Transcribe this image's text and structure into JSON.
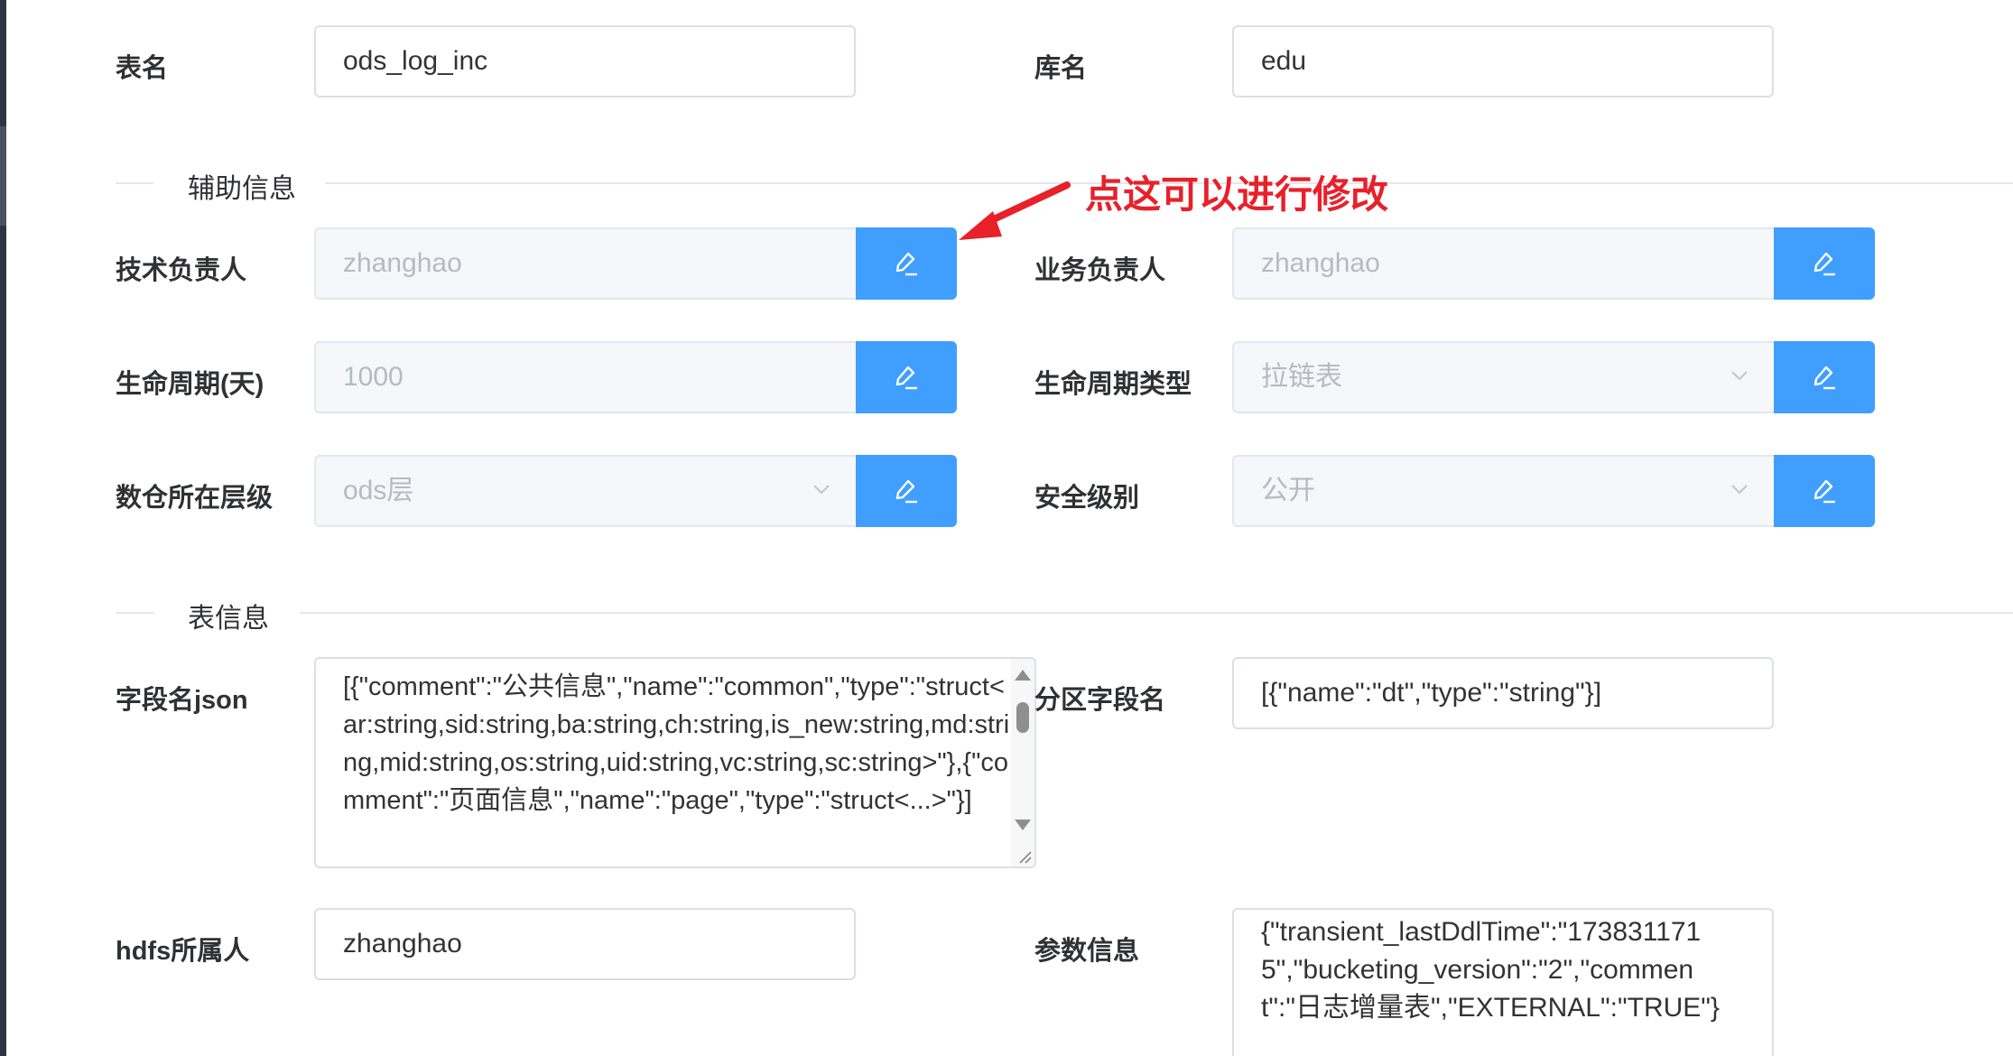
{
  "colors": {
    "accent": "#409eff",
    "annotation": "#e8202a"
  },
  "fields": {
    "table_name": {
      "label": "表名",
      "value": "ods_log_inc"
    },
    "db_name": {
      "label": "库名",
      "value": "edu"
    },
    "tech_owner": {
      "label": "技术负责人",
      "value": "zhanghao"
    },
    "biz_owner": {
      "label": "业务负责人",
      "value": "zhanghao"
    },
    "lifecycle_days": {
      "label": "生命周期(天)",
      "value": "1000"
    },
    "lifecycle_type": {
      "label": "生命周期类型",
      "value": "拉链表"
    },
    "dw_layer": {
      "label": "数仓所在层级",
      "value": "ods层"
    },
    "security_level": {
      "label": "安全级别",
      "value": "公开"
    },
    "columns_json": {
      "label": "字段名json",
      "value": "[{\"comment\":\"公共信息\",\"name\":\"common\",\"type\":\"struct<ar:string,sid:string,ba:string,ch:string,is_new:string,md:string,mid:string,os:string,uid:string,vc:string,sc:string>\"},{\"comment\":\"页面信息\",\"name\":\"page\",\"type\":\"struct<...>\"}]"
    },
    "partition_fields": {
      "label": "分区字段名",
      "value": "[{\"name\":\"dt\",\"type\":\"string\"}]"
    },
    "hdfs_owner": {
      "label": "hdfs所属人",
      "value": "zhanghao"
    },
    "params": {
      "label": "参数信息",
      "value": "{\"transient_lastDdlTime\":\"1738311715\",\"bucketing_version\":\"2\",\"comment\":\"日志增量表\",\"EXTERNAL\":\"TRUE\"}"
    }
  },
  "sections": {
    "aux_info": "辅助信息",
    "table_info": "表信息"
  },
  "annotation": {
    "text": "点这可以进行修改"
  },
  "icons": {
    "edit": "edit-pencil-icon",
    "dropdown": "chevron-down-icon"
  }
}
